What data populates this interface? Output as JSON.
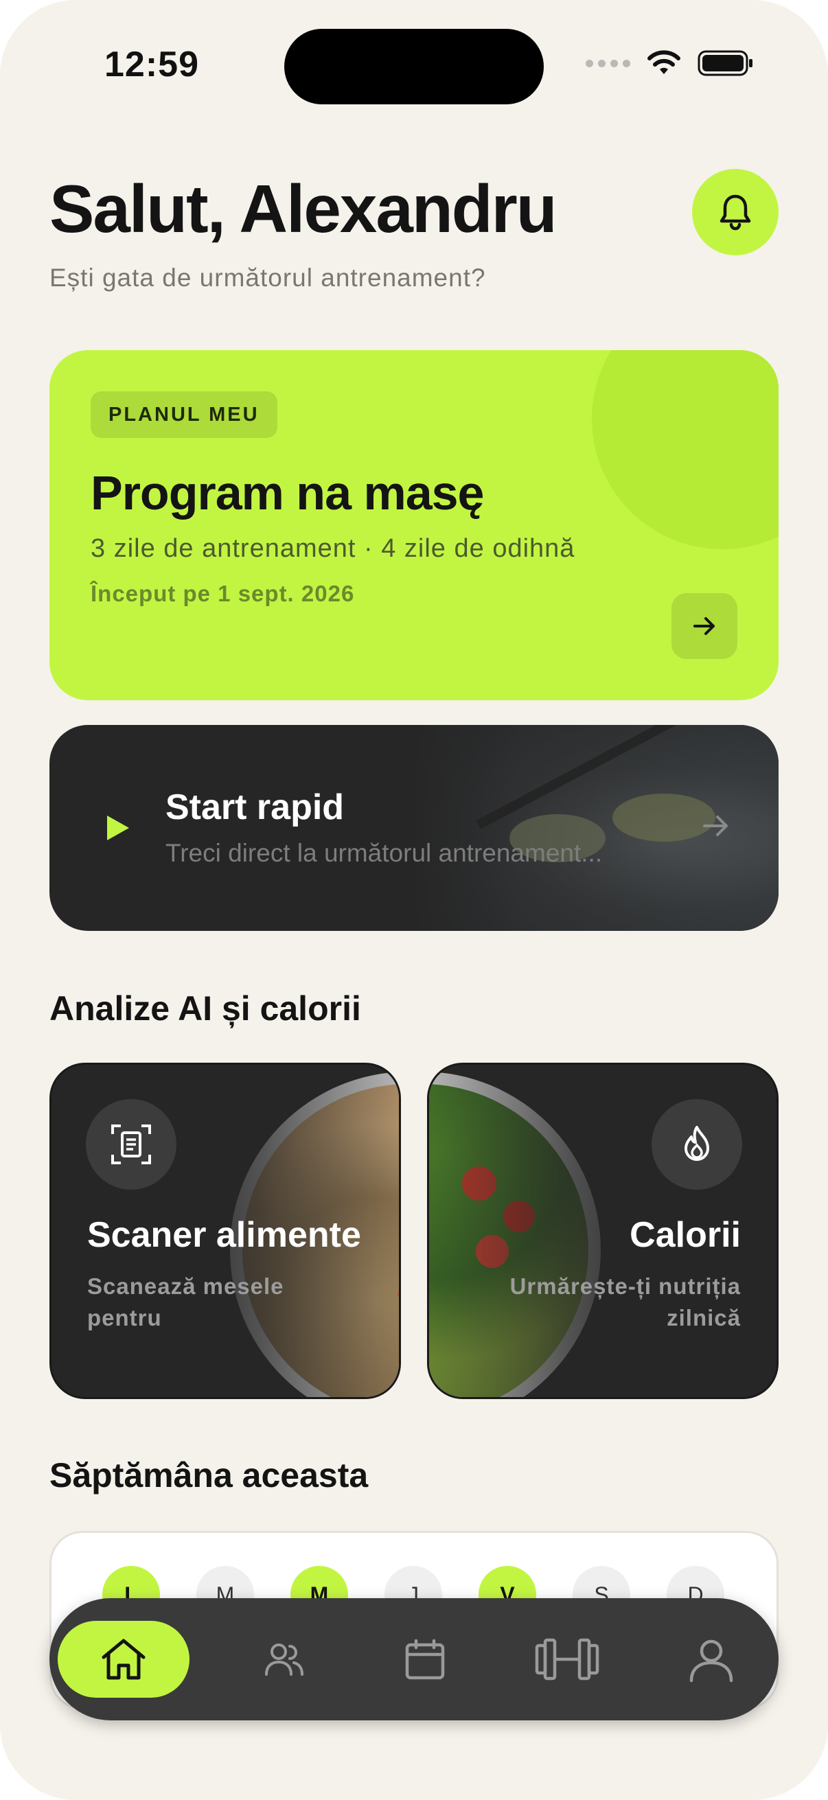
{
  "status_bar": {
    "time": "12:59"
  },
  "header": {
    "greeting": "Salut, Alexandru",
    "subtitle": "Ești gata de următorul antrenament?"
  },
  "plan_card": {
    "tag": "PLANUL MEU",
    "title": "Program na masę",
    "schedule": "3 zile de antrenament · 4 zile de odihnă",
    "start_date": "Început pe 1 sept. 2026"
  },
  "quick_start": {
    "title": "Start rapid",
    "subtitle": "Treci direct la următorul antrenament..."
  },
  "ai_section": {
    "title": "Analize AI și calorii",
    "cards": [
      {
        "title": "Scaner alimente",
        "subtitle": "Scanează mesele pentru",
        "icon": "scan-document-icon"
      },
      {
        "title": "Calorii",
        "subtitle": "Urmărește-ți nutriția zilnică",
        "icon": "flame-icon"
      }
    ]
  },
  "week_section": {
    "title": "Săptămâna aceasta",
    "days": [
      {
        "label": "L",
        "active": true
      },
      {
        "label": "M",
        "active": false
      },
      {
        "label": "M",
        "active": true
      },
      {
        "label": "J",
        "active": false
      },
      {
        "label": "V",
        "active": true
      },
      {
        "label": "S",
        "active": false
      },
      {
        "label": "D",
        "active": false
      }
    ]
  },
  "bottom_nav": {
    "items": [
      {
        "icon": "home-icon",
        "active": true
      },
      {
        "icon": "users-icon",
        "active": false
      },
      {
        "icon": "calendar-icon",
        "active": false
      },
      {
        "icon": "dumbbell-icon",
        "active": false
      },
      {
        "icon": "profile-icon",
        "active": false
      }
    ]
  },
  "colors": {
    "accent": "#c2f542",
    "dark_card": "#262626",
    "background": "#f5f2eb"
  }
}
